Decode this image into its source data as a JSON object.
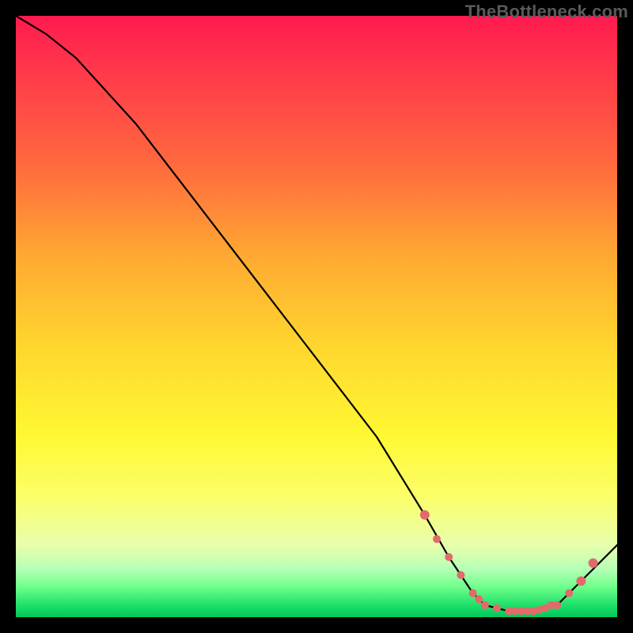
{
  "watermark": "TheBottleneck.com",
  "chart_data": {
    "type": "line",
    "title": "",
    "xlabel": "",
    "ylabel": "",
    "xlim": [
      0,
      100
    ],
    "ylim": [
      0,
      100
    ],
    "series": [
      {
        "name": "curve",
        "x": [
          0,
          5,
          10,
          20,
          30,
          40,
          50,
          60,
          68,
          72,
          76,
          78,
          82,
          86,
          90,
          92,
          94,
          100
        ],
        "y": [
          100,
          97,
          93,
          82,
          69,
          56,
          43,
          30,
          17,
          10,
          4,
          2,
          1,
          1,
          2,
          4,
          6,
          12
        ]
      }
    ],
    "points": {
      "name": "highlight-dots",
      "x": [
        68,
        70,
        72,
        74,
        76,
        77,
        78,
        80,
        82,
        83,
        84,
        85,
        86,
        87,
        88,
        89,
        90,
        92,
        94,
        96
      ],
      "y": [
        17,
        13,
        10,
        7,
        4,
        3,
        2,
        1.5,
        1,
        1,
        1,
        1,
        1,
        1.2,
        1.5,
        2,
        2,
        4,
        6,
        9
      ]
    },
    "gradient_stops": [
      {
        "pos": 0.0,
        "color": "#ff1a4f"
      },
      {
        "pos": 0.25,
        "color": "#ff6a3e"
      },
      {
        "pos": 0.55,
        "color": "#ffd62e"
      },
      {
        "pos": 0.8,
        "color": "#fbff6a"
      },
      {
        "pos": 0.95,
        "color": "#6dff8a"
      },
      {
        "pos": 1.0,
        "color": "#00c85a"
      }
    ]
  }
}
